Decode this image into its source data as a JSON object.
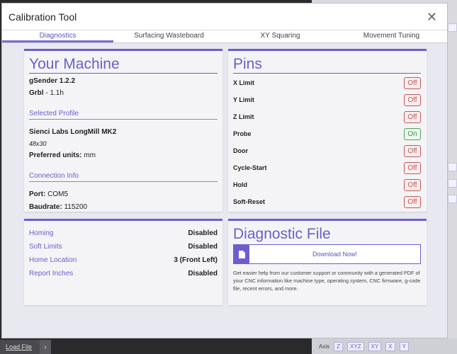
{
  "window": {
    "title": "Calibration Tool"
  },
  "tabs": [
    {
      "label": "Diagnostics",
      "active": true
    },
    {
      "label": "Surfacing Wasteboard",
      "active": false
    },
    {
      "label": "XY Squaring",
      "active": false
    },
    {
      "label": "Movement Tuning",
      "active": false
    }
  ],
  "machine": {
    "heading": "Your Machine",
    "software": "gSender 1.2.2",
    "firmware_label": "Grbl",
    "firmware_version": " - 1.1h",
    "profile_heading": "Selected Profile",
    "profile_name": "Sienci Labs LongMill MK2",
    "profile_size": "48x30",
    "units_label": "Preferred units:",
    "units_value": " mm",
    "connection_heading": "Connection Info",
    "port_label": "Port:",
    "port_value": " COM5",
    "baud_label": "Baudrate:",
    "baud_value": " 115200"
  },
  "pins": {
    "heading": "Pins",
    "items": [
      {
        "name": "X Limit",
        "state": "Off"
      },
      {
        "name": "Y Limit",
        "state": "Off"
      },
      {
        "name": "Z Limit",
        "state": "Off"
      },
      {
        "name": "Probe",
        "state": "On"
      },
      {
        "name": "Door",
        "state": "Off"
      },
      {
        "name": "Cycle-Start",
        "state": "Off"
      },
      {
        "name": "Hold",
        "state": "Off"
      },
      {
        "name": "Soft-Reset",
        "state": "Off"
      }
    ]
  },
  "settings": [
    {
      "label": "Homing",
      "value": "Disabled"
    },
    {
      "label": "Soft Limits",
      "value": "Disabled"
    },
    {
      "label": "Home Location",
      "value": "3 (Front Left)"
    },
    {
      "label": "Report Inches",
      "value": "Disabled"
    }
  ],
  "diag": {
    "heading": "Diagnostic File",
    "button": "Download Now!",
    "description": "Get easier help from our customer support or community with a generated PDF of your CNC information like machine type, operating system, CNC firmware, g-code file, recent errors, and more."
  },
  "background": {
    "load_file": "Load File",
    "axis_label": "Axis",
    "axis_buttons": [
      "Z",
      "XYZ",
      "XY",
      "X",
      "Y"
    ]
  },
  "colors": {
    "accent": "#6e5ecd",
    "off": "#c05a5a",
    "on": "#4da15a"
  }
}
